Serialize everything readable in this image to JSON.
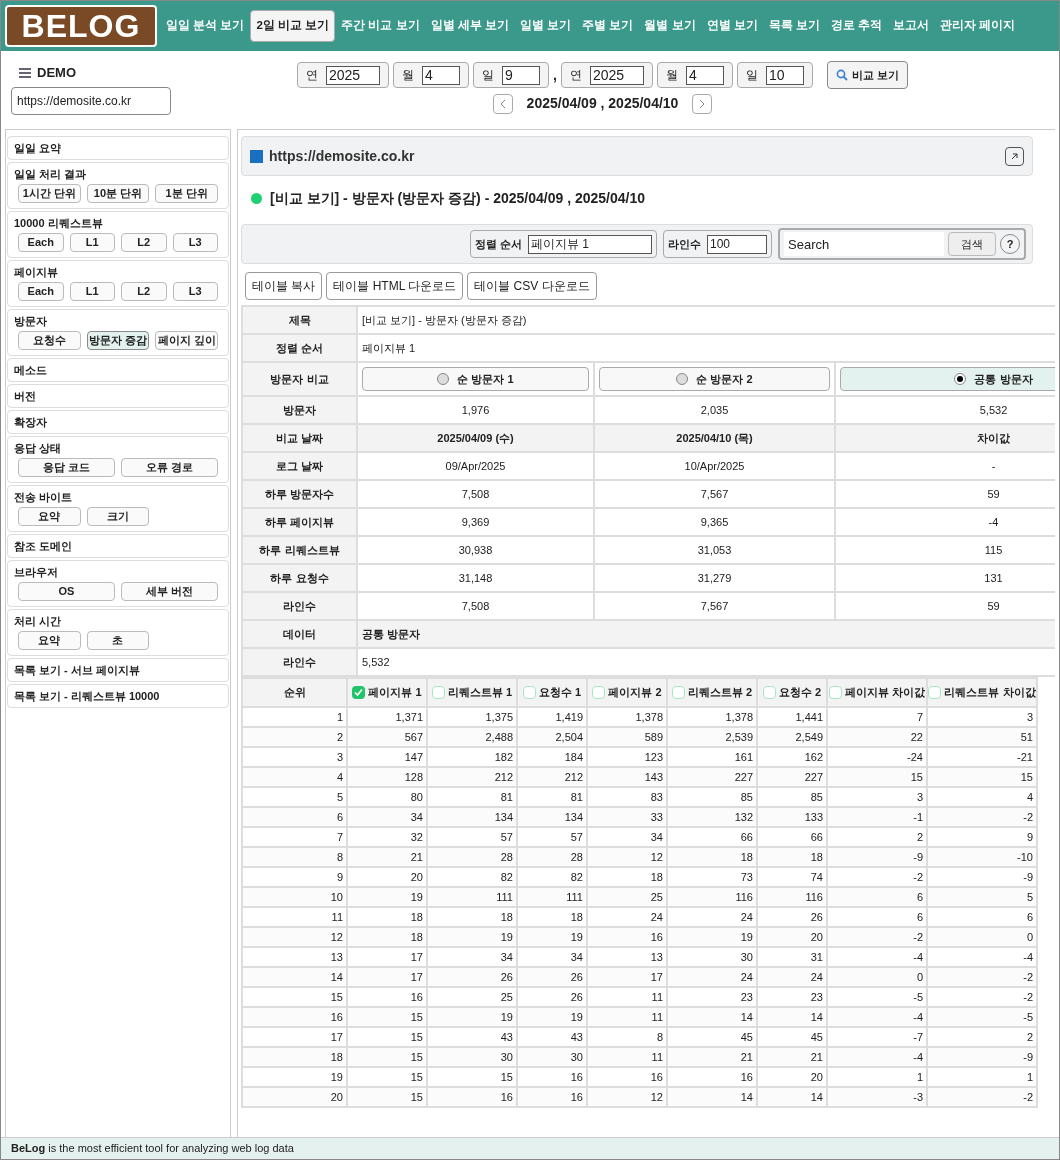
{
  "logo": "BELOG",
  "nav": [
    {
      "label": "일일 분석 보기",
      "selected": false
    },
    {
      "label": "2일 비교 보기",
      "selected": true
    },
    {
      "label": "주간 비교 보기",
      "selected": false
    },
    {
      "label": "일별 세부 보기",
      "selected": false
    },
    {
      "label": "일별 보기",
      "selected": false
    },
    {
      "label": "주별 보기",
      "selected": false
    },
    {
      "label": "월별 보기",
      "selected": false
    },
    {
      "label": "연별 보기",
      "selected": false
    },
    {
      "label": "목록 보기",
      "selected": false
    },
    {
      "label": "경로 추적",
      "selected": false
    },
    {
      "label": "보고서",
      "selected": false
    },
    {
      "label": "관리자 페이지",
      "selected": false
    }
  ],
  "site": {
    "name": "DEMO",
    "url": "https://demosite.co.kr"
  },
  "date_range": {
    "start": [
      {
        "label": "연",
        "value": "2025"
      },
      {
        "label": "월",
        "value": "4"
      },
      {
        "label": "일",
        "value": "9"
      }
    ],
    "separator": ",",
    "end": [
      {
        "label": "연",
        "value": "2025"
      },
      {
        "label": "월",
        "value": "4"
      },
      {
        "label": "일",
        "value": "10"
      }
    ],
    "button": "비교 보기",
    "display": "2025/04/09 , 2025/04/10"
  },
  "sidebar": [
    {
      "title": "일일 요약"
    },
    {
      "title": "일일 처리 결과",
      "buttons": [
        {
          "label": "1시간 단위",
          "selected": false
        },
        {
          "label": "10분 단위",
          "selected": false
        },
        {
          "label": "1분 단위",
          "selected": false
        }
      ]
    },
    {
      "title": "10000 리퀘스트뷰",
      "buttons": [
        {
          "label": "Each",
          "selected": false
        },
        {
          "label": "L1",
          "selected": false
        },
        {
          "label": "L2",
          "selected": false
        },
        {
          "label": "L3",
          "selected": false
        }
      ]
    },
    {
      "title": "페이지뷰",
      "buttons": [
        {
          "label": "Each",
          "selected": false
        },
        {
          "label": "L1",
          "selected": false
        },
        {
          "label": "L2",
          "selected": false
        },
        {
          "label": "L3",
          "selected": false
        }
      ]
    },
    {
      "title": "방문자",
      "buttons": [
        {
          "label": "요청수",
          "selected": false
        },
        {
          "label": "방문자 증감",
          "selected": true
        },
        {
          "label": "페이지 깊이",
          "selected": false
        }
      ]
    },
    {
      "title": "메소드"
    },
    {
      "title": "버전"
    },
    {
      "title": "확장자"
    },
    {
      "title": "응답 상태",
      "buttons": [
        {
          "label": "응답 코드",
          "selected": false
        },
        {
          "label": "오류 경로",
          "selected": false
        }
      ],
      "wide": true
    },
    {
      "title": "전송 바이트",
      "buttons": [
        {
          "label": "요약",
          "selected": false
        },
        {
          "label": "크기",
          "selected": false
        }
      ]
    },
    {
      "title": "참조 도메인"
    },
    {
      "title": "브라우저",
      "buttons": [
        {
          "label": "OS",
          "selected": false
        },
        {
          "label": "세부 버전",
          "selected": false
        }
      ],
      "wide": true
    },
    {
      "title": "처리 시간",
      "buttons": [
        {
          "label": "요약",
          "selected": false
        },
        {
          "label": "초",
          "selected": false
        }
      ]
    },
    {
      "title": "목록 보기 - 서브 페이지뷰"
    },
    {
      "title": "목록 보기 - 리퀘스트뷰 10000"
    }
  ],
  "panel": {
    "title": "https://demosite.co.kr",
    "heading": "[비교 보기] - 방문자 (방문자 증감) - 2025/04/09 , 2025/04/10"
  },
  "toolbar": {
    "sort_label": "정렬 순서",
    "sort_value": "페이지뷰 1",
    "lines_label": "라인수",
    "lines_value": "100",
    "search_value": "Search",
    "search_button": "검색",
    "help": "?"
  },
  "actions": [
    "테이블 복사",
    "테이블 HTML 다운로드",
    "테이블 CSV 다운로드"
  ],
  "summary": [
    {
      "kind": "text",
      "label": "제목",
      "value": "[비교 보기] - 방문자 (방문자 증감)"
    },
    {
      "kind": "text",
      "label": "정렬 순서",
      "value": "페이지뷰 1"
    },
    {
      "kind": "options",
      "label": "방문자 비교",
      "options": [
        {
          "label": "순 방문자 1",
          "selected": false
        },
        {
          "label": "순 방문자 2",
          "selected": false
        },
        {
          "label": "공통 방문자",
          "selected": true
        }
      ]
    },
    {
      "kind": "values",
      "label": "방문자",
      "values": [
        "1,976",
        "2,035",
        "5,532"
      ]
    },
    {
      "kind": "header",
      "label": "비교 날짜",
      "values": [
        "2025/04/09 (수)",
        "2025/04/10 (목)",
        "차이값"
      ]
    },
    {
      "kind": "values",
      "label": "로그 날짜",
      "values": [
        "09/Apr/2025",
        "10/Apr/2025",
        "-"
      ]
    },
    {
      "kind": "values",
      "label": "하루 방문자수",
      "values": [
        "7,508",
        "7,567",
        "59"
      ]
    },
    {
      "kind": "values",
      "label": "하루 페이지뷰",
      "values": [
        "9,369",
        "9,365",
        "-4"
      ]
    },
    {
      "kind": "values",
      "label": "하루 리퀘스트뷰",
      "values": [
        "30,938",
        "31,053",
        "115"
      ]
    },
    {
      "kind": "values",
      "label": "하루 요청수",
      "values": [
        "31,148",
        "31,279",
        "131"
      ]
    },
    {
      "kind": "values",
      "label": "라인수",
      "values": [
        "7,508",
        "7,567",
        "59"
      ]
    },
    {
      "kind": "section",
      "label": "데이터",
      "value": "공통 방문자"
    },
    {
      "kind": "text",
      "label": "라인수",
      "value": "5,532"
    }
  ],
  "grid": {
    "columns": [
      {
        "label": "순위"
      },
      {
        "label": "페이지뷰 1",
        "checked": true
      },
      {
        "label": "리퀘스트뷰 1",
        "checked": false
      },
      {
        "label": "요청수 1",
        "checked": false
      },
      {
        "label": "페이지뷰 2",
        "checked": false
      },
      {
        "label": "리퀘스트뷰 2",
        "checked": false
      },
      {
        "label": "요청수 2",
        "checked": false
      },
      {
        "label": "페이지뷰 차이값",
        "checked": false
      },
      {
        "label": "리퀘스트뷰 차이값",
        "checked": false
      }
    ],
    "rows": [
      [
        "1",
        "1,371",
        "1,375",
        "1,419",
        "1,378",
        "1,378",
        "1,441",
        "7",
        "3"
      ],
      [
        "2",
        "567",
        "2,488",
        "2,504",
        "589",
        "2,539",
        "2,549",
        "22",
        "51"
      ],
      [
        "3",
        "147",
        "182",
        "184",
        "123",
        "161",
        "162",
        "-24",
        "-21"
      ],
      [
        "4",
        "128",
        "212",
        "212",
        "143",
        "227",
        "227",
        "15",
        "15"
      ],
      [
        "5",
        "80",
        "81",
        "81",
        "83",
        "85",
        "85",
        "3",
        "4"
      ],
      [
        "6",
        "34",
        "134",
        "134",
        "33",
        "132",
        "133",
        "-1",
        "-2"
      ],
      [
        "7",
        "32",
        "57",
        "57",
        "34",
        "66",
        "66",
        "2",
        "9"
      ],
      [
        "8",
        "21",
        "28",
        "28",
        "12",
        "18",
        "18",
        "-9",
        "-10"
      ],
      [
        "9",
        "20",
        "82",
        "82",
        "18",
        "73",
        "74",
        "-2",
        "-9"
      ],
      [
        "10",
        "19",
        "111",
        "111",
        "25",
        "116",
        "116",
        "6",
        "5"
      ],
      [
        "11",
        "18",
        "18",
        "18",
        "24",
        "24",
        "26",
        "6",
        "6"
      ],
      [
        "12",
        "18",
        "19",
        "19",
        "16",
        "19",
        "20",
        "-2",
        "0"
      ],
      [
        "13",
        "17",
        "34",
        "34",
        "13",
        "30",
        "31",
        "-4",
        "-4"
      ],
      [
        "14",
        "17",
        "26",
        "26",
        "17",
        "24",
        "24",
        "0",
        "-2"
      ],
      [
        "15",
        "16",
        "25",
        "26",
        "11",
        "23",
        "23",
        "-5",
        "-2"
      ],
      [
        "16",
        "15",
        "19",
        "19",
        "11",
        "14",
        "14",
        "-4",
        "-5"
      ],
      [
        "17",
        "15",
        "43",
        "43",
        "8",
        "45",
        "45",
        "-7",
        "2"
      ],
      [
        "18",
        "15",
        "30",
        "30",
        "11",
        "21",
        "21",
        "-4",
        "-9"
      ],
      [
        "19",
        "15",
        "15",
        "16",
        "16",
        "16",
        "20",
        "1",
        "1"
      ],
      [
        "20",
        "15",
        "16",
        "16",
        "12",
        "14",
        "14",
        "-3",
        "-2"
      ]
    ]
  },
  "footer": "**BeLog** is the most efficient tool for analyzing web log data"
}
